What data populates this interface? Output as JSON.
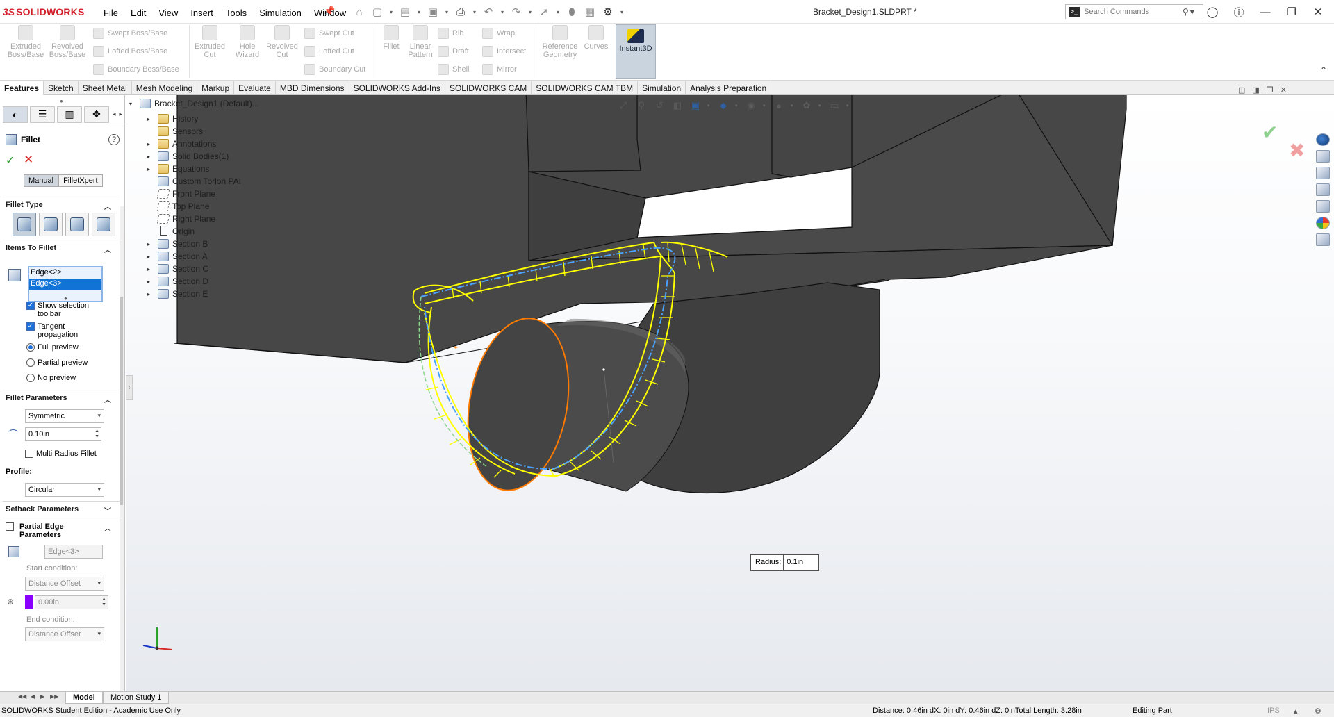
{
  "app": {
    "logo_prefix": "3S",
    "logo_text": "SOLIDWORKS",
    "document_title": "Bracket_Design1.SLDPRT *"
  },
  "menu": [
    "File",
    "Edit",
    "View",
    "Insert",
    "Tools",
    "Simulation",
    "Window"
  ],
  "search": {
    "placeholder": "Search Commands"
  },
  "ribbon": {
    "extruded_boss": "Extruded\nBoss/Base",
    "revolved_boss": "Revolved\nBoss/Base",
    "swept_boss": "Swept Boss/Base",
    "lofted_boss": "Lofted Boss/Base",
    "boundary_boss": "Boundary Boss/Base",
    "extruded_cut": "Extruded\nCut",
    "hole_wizard": "Hole\nWizard",
    "revolved_cut": "Revolved\nCut",
    "swept_cut": "Swept Cut",
    "lofted_cut": "Lofted Cut",
    "boundary_cut": "Boundary Cut",
    "fillet": "Fillet",
    "linear_pattern": "Linear\nPattern",
    "rib": "Rib",
    "draft": "Draft",
    "shell": "Shell",
    "wrap": "Wrap",
    "intersect": "Intersect",
    "mirror": "Mirror",
    "reference_geometry": "Reference\nGeometry",
    "curves": "Curves",
    "instant3d": "Instant3D"
  },
  "tabs": [
    "Features",
    "Sketch",
    "Sheet Metal",
    "Mesh Modeling",
    "Markup",
    "Evaluate",
    "MBD Dimensions",
    "SOLIDWORKS Add-Ins",
    "SOLIDWORKS CAM",
    "SOLIDWORKS CAM TBM",
    "Simulation",
    "Analysis Preparation"
  ],
  "property_manager": {
    "title": "Fillet",
    "help": "?",
    "ok": "✓",
    "cancel": "✕",
    "mode_manual": "Manual",
    "mode_filletxpert": "FilletXpert",
    "fillet_type_label": "Fillet Type",
    "items_label": "Items To Fillet",
    "edges": [
      "Edge<2>",
      "Edge<3>"
    ],
    "show_selection_toolbar": "Show selection toolbar",
    "tangent_propagation": "Tangent propagation",
    "full_preview": "Full preview",
    "partial_preview": "Partial preview",
    "no_preview": "No preview",
    "fillet_parameters_label": "Fillet Parameters",
    "symmetric": "Symmetric",
    "radius_value": "0.10in",
    "multi_radius": "Multi Radius Fillet",
    "profile_label": "Profile:",
    "profile_value": "Circular",
    "setback_label": "Setback Parameters",
    "partial_edge_label": "Partial Edge Parameters",
    "partial_edge_value": "Edge<3>",
    "start_condition_label": "Start condition:",
    "start_condition_value": "Distance Offset",
    "offset_value": "0.00in",
    "end_condition_label": "End condition:",
    "end_condition_value": "Distance Offset"
  },
  "feature_tree": {
    "root": "Bracket_Design1 (Default)...",
    "items": [
      "History",
      "Sensors",
      "Annotations",
      "Solid Bodies(1)",
      "Equations",
      "Custom Torlon PAI",
      "Front Plane",
      "Top Plane",
      "Right Plane",
      "Origin",
      "Section B",
      "Section A",
      "Section C",
      "Section D",
      "Section E"
    ]
  },
  "callout": {
    "label": "Radius:",
    "value": "0.1in"
  },
  "bottom_tabs": [
    "Model",
    "Motion Study 1"
  ],
  "status": {
    "edition": "SOLIDWORKS Student Edition - Academic Use Only",
    "measure": "Distance: 0.46in   dX: 0in   dY: 0.46in   dZ: 0inTotal Length: 3.28in",
    "mode": "Editing Part",
    "units": "IPS"
  },
  "colors": {
    "accent": "#d4202c",
    "selection_yellow": "#ffff00",
    "edge_orange": "#ff7a00",
    "edge_blue": "#4aa3ff",
    "model_body": "#474747"
  }
}
